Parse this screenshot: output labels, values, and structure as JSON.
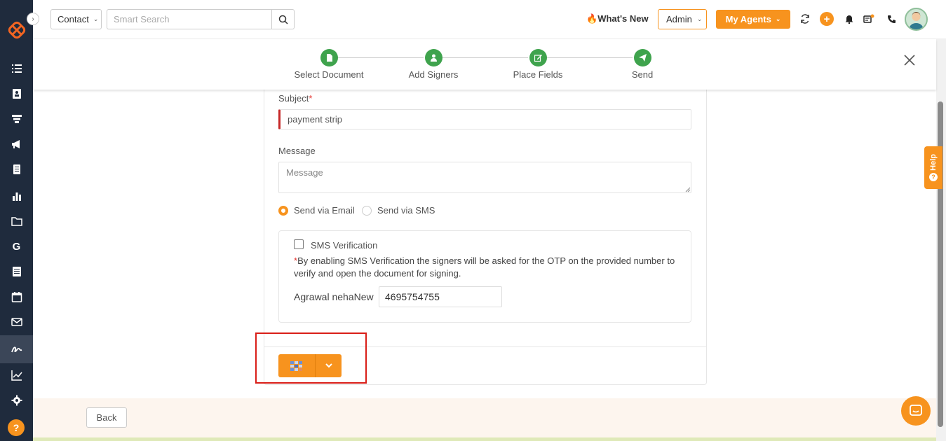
{
  "topbar": {
    "contact_select": "Contact",
    "search_placeholder": "Smart Search",
    "whats_new": "What's New",
    "admin_select": "Admin",
    "agents_button": "My Agents"
  },
  "stepper": {
    "steps": [
      {
        "label": "Select Document",
        "icon": "file-icon"
      },
      {
        "label": "Add Signers",
        "icon": "user-icon"
      },
      {
        "label": "Place Fields",
        "icon": "edit-icon"
      },
      {
        "label": "Send",
        "icon": "paper-plane-icon"
      }
    ]
  },
  "form": {
    "subject_label": "Subject",
    "subject_required_mark": "*",
    "subject_value": "payment strip",
    "message_label": "Message",
    "message_placeholder": "Message",
    "send_via_email": "Send via Email",
    "send_via_sms": "Send via SMS",
    "selected_method": "email",
    "sms_verification_label": "SMS Verification",
    "sms_required_mark": "*",
    "sms_note": "By enabling SMS Verification the signers will be asked for the OTP on the provided number to verify and open the document for signing.",
    "signer_name": "Agrawal nehaNew",
    "signer_phone": "4695754755"
  },
  "footer": {
    "back_button": "Back"
  },
  "help_tab": "Help",
  "colors": {
    "accent": "#f7931e",
    "sidebar": "#1f2b3d",
    "step_complete": "#3fa34d",
    "highlight": "#d91e18",
    "required": "#e53935"
  }
}
